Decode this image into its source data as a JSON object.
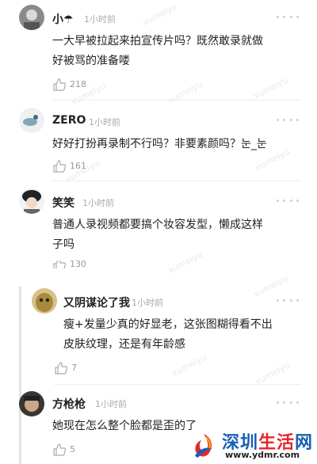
{
  "comments": [
    {
      "username": "小☂",
      "time": "1小时前",
      "lines": [
        "一大早被拉起来拍宣传片吗？既然敢录就做",
        "好被骂的准备喽"
      ],
      "likes": "218"
    },
    {
      "username": "ZERO",
      "time": "1小时前",
      "lines": [
        "好好打扮再录制不行吗？非要素颜吗？눈_눈"
      ],
      "likes": "161"
    },
    {
      "username": "笑笑",
      "time": "1小时前",
      "lines": [
        "普通人录视频都要搞个妆容发型，懒成这样",
        "子吗"
      ],
      "likes": "130"
    },
    {
      "username": "又阴谋论了我",
      "time": "1小时前",
      "lines": [
        "瘦+发量少真的好显老，这张图糊得看不出",
        "皮肤纹理，还是有年龄感"
      ],
      "likes": "7"
    },
    {
      "username": "方枪枪",
      "time": "1小时前",
      "lines": [
        "她现在怎么整个脸都是歪的了"
      ],
      "likes": "5"
    }
  ],
  "watermark": "xumeiyu",
  "logo": {
    "name": "深圳生活网",
    "url": "www.ydmr.com"
  },
  "colors": {
    "logo_red": "#e8262a",
    "logo_blue": "#1a5fb4",
    "divider": "#eeeeee"
  }
}
